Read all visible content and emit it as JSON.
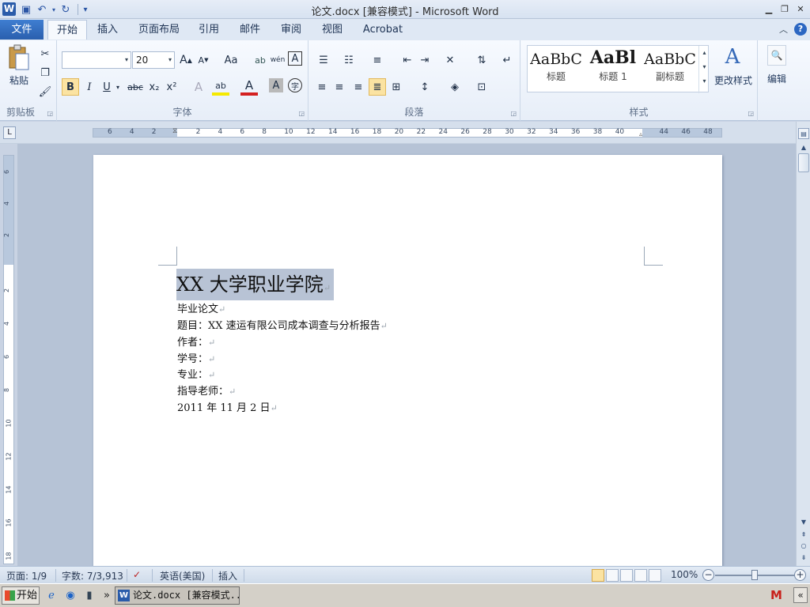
{
  "window": {
    "title": "论文.docx [兼容模式] - Microsoft Word"
  },
  "qat": {
    "word_icon": "word-icon",
    "save": "save-icon",
    "undo": "undo-icon",
    "redo": "redo-icon",
    "customize": "▾"
  },
  "tabs": {
    "file": "文件",
    "items": [
      "开始",
      "插入",
      "页面布局",
      "引用",
      "邮件",
      "审阅",
      "视图",
      "Acrobat"
    ]
  },
  "ribbon": {
    "clipboard": {
      "label": "剪贴板",
      "paste": "粘贴"
    },
    "font": {
      "label": "字体",
      "font_name": "",
      "font_size": "20",
      "grow": "A",
      "shrink": "A",
      "case": "Aa",
      "clear": "ab",
      "phonetic": "wén",
      "border": "A",
      "bold": "B",
      "italic": "I",
      "underline": "U",
      "strike": "abc",
      "sub": "x₂",
      "sup": "x²",
      "highlight": "ab",
      "color": "A",
      "shade": "A",
      "circle": "字"
    },
    "paragraph": {
      "label": "段落"
    },
    "styles": {
      "label": "样式",
      "items": [
        {
          "sample": "AaBbC",
          "name": "标题"
        },
        {
          "sample": "AaBl",
          "name": "标题 1"
        },
        {
          "sample": "AaBbC",
          "name": "副标题"
        }
      ],
      "change": "更改样式"
    },
    "editing": {
      "label": "编辑"
    }
  },
  "ruler": {
    "numbers": [
      "6",
      "4",
      "2",
      "",
      "2",
      "4",
      "6",
      "8",
      "10",
      "12",
      "14",
      "16",
      "18",
      "20",
      "22",
      "24",
      "26",
      "28",
      "30",
      "32",
      "34",
      "36",
      "38",
      "40",
      "",
      "44",
      "46",
      "48"
    ],
    "vnumbers": [
      "6",
      "4",
      "2",
      "2",
      "4",
      "6",
      "8",
      "10",
      "12",
      "14",
      "16",
      "18"
    ],
    "corner": "L"
  },
  "document": {
    "title": "XX 大学职业学院",
    "lines": [
      "毕业论文",
      "题目：XX 速运有限公司成本调查与分析报告",
      "作者：",
      "学号：",
      "专业：",
      "指导老师：",
      "2011 年 11 月 2 日"
    ],
    "para_mark": "↵"
  },
  "status": {
    "page": "页面: 1/9",
    "words": "字数: 7/3,913",
    "language": "英语(美国)",
    "mode": "插入",
    "zoom": "100%",
    "zoom_level": 1.0
  },
  "taskbar": {
    "start": "开始",
    "task": "论文.docx [兼容模式...",
    "tray_icon": "M",
    "more": "»",
    "collapse": "«"
  }
}
